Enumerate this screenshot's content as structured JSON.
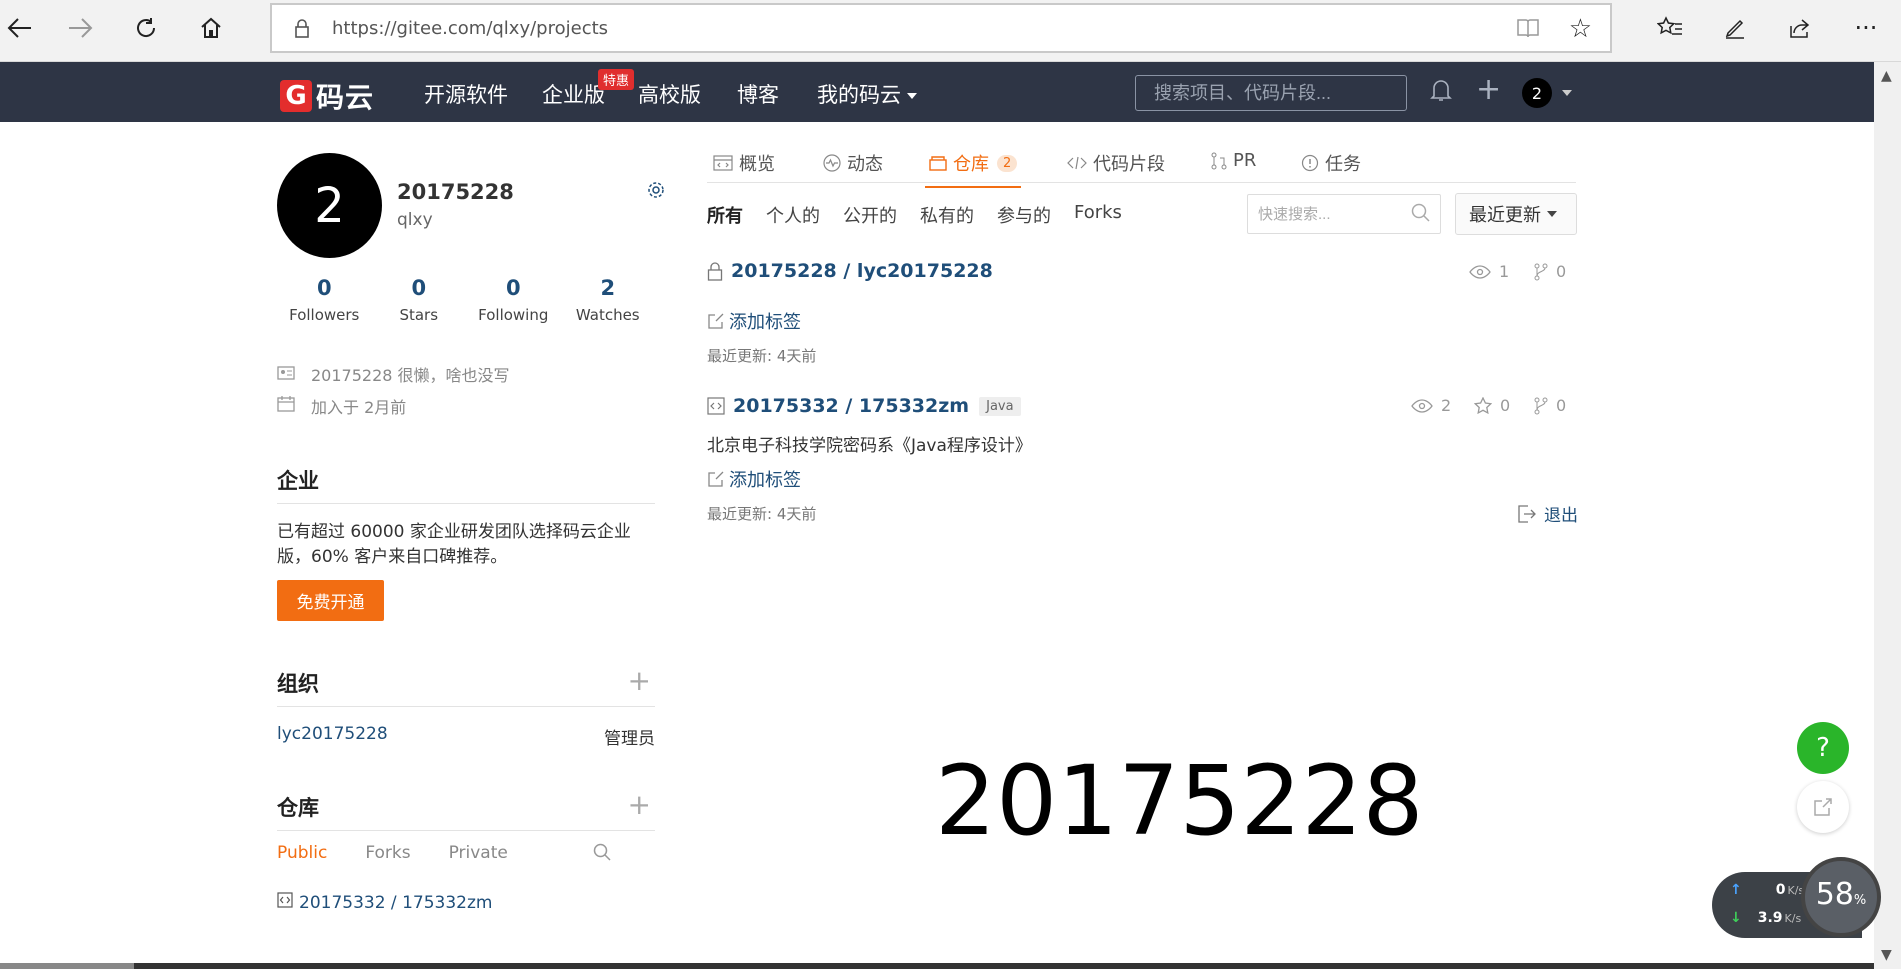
{
  "browser": {
    "url": "https://gitee.com/qlxy/projects"
  },
  "topnav": {
    "logo_letter": "G",
    "logo_text": "码云",
    "menu": [
      "开源软件",
      "企业版",
      "高校版",
      "博客",
      "我的码云"
    ],
    "hot_badge": "特惠",
    "search_placeholder": "搜索项目、代码片段...",
    "avatar_letter": "2"
  },
  "profile": {
    "avatar_letter": "2",
    "name": "20175228",
    "login": "qlxy",
    "stats": [
      {
        "num": "0",
        "label": "Followers"
      },
      {
        "num": "0",
        "label": "Stars"
      },
      {
        "num": "0",
        "label": "Following"
      },
      {
        "num": "2",
        "label": "Watches"
      }
    ],
    "bio": "20175228 很懒，啥也没写",
    "joined": "加入于 2月前"
  },
  "enterprise": {
    "title": "企业",
    "text": "已有超过 60000 家企业研发团队选择码云企业版，60% 客户来自口碑推荐。",
    "button": "免费开通"
  },
  "orgs": {
    "title": "组织",
    "items": [
      {
        "name": "lyc20175228",
        "role": "管理员"
      }
    ]
  },
  "repos_side": {
    "title": "仓库",
    "tabs": [
      "Public",
      "Forks",
      "Private"
    ],
    "items": [
      "20175332 / 175332zm"
    ]
  },
  "tabs": [
    {
      "label": "概览"
    },
    {
      "label": "动态"
    },
    {
      "label": "仓库",
      "count": "2"
    },
    {
      "label": "代码片段"
    },
    {
      "label": "PR"
    },
    {
      "label": "任务"
    }
  ],
  "filters": [
    "所有",
    "个人的",
    "公开的",
    "私有的",
    "参与的",
    "Forks"
  ],
  "quick_search_placeholder": "快速搜索...",
  "sort_label": "最近更新",
  "repos": [
    {
      "title": "20175228 / lyc20175228",
      "watch": "1",
      "fork": "0",
      "add_tag": "添加标签",
      "updated": "最近更新: 4天前"
    },
    {
      "title": "20175332 / 175332zm",
      "lang": "Java",
      "watch": "2",
      "star": "0",
      "fork": "0",
      "desc": "北京电子科技学院密码系《Java程序设计》",
      "add_tag": "添加标签",
      "updated": "最近更新: 4天前"
    }
  ],
  "logout": "退出",
  "big_overlay": "20175228",
  "float": {
    "help": "?",
    "up_speed": "0",
    "down_speed": "3.9",
    "speed_unit": "K/s",
    "gauge": "58",
    "gauge_unit": "%"
  },
  "colors": {
    "nav_bg": "#2e3545",
    "accent": "#f26d12",
    "link": "#1f4e79",
    "help_green": "#2ab52a"
  }
}
